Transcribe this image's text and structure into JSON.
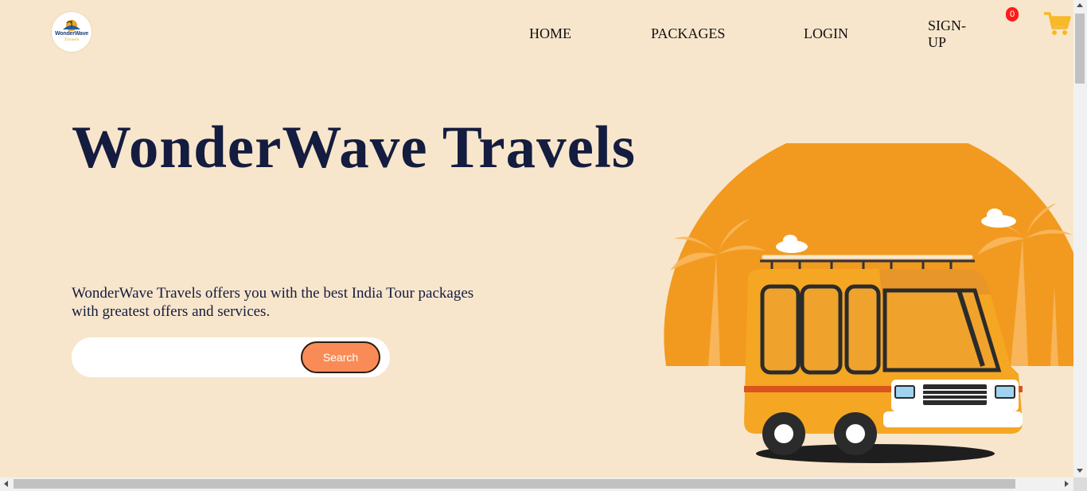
{
  "brand": {
    "logo_text": "WonderWave",
    "logo_sub": "Travels"
  },
  "nav": {
    "home": "HOME",
    "packages": "PACKAGES",
    "login": "LOGIN",
    "signup": "SIGN-UP"
  },
  "cart": {
    "count": "0",
    "icon": "shopping-cart-icon",
    "color": "#f7b928",
    "badge_color": "#ff1a1a"
  },
  "hero": {
    "title": "WonderWave Travels",
    "description": "WonderWave Travels offers you with the best India Tour packages with greatest offers and services."
  },
  "search": {
    "value": "",
    "placeholder": "",
    "button_label": "Search"
  },
  "colors": {
    "background": "#f8e6cc",
    "title": "#141c3f",
    "search_button": "#f98c56",
    "sun": "#f29a1f",
    "van": "#f5a623"
  }
}
